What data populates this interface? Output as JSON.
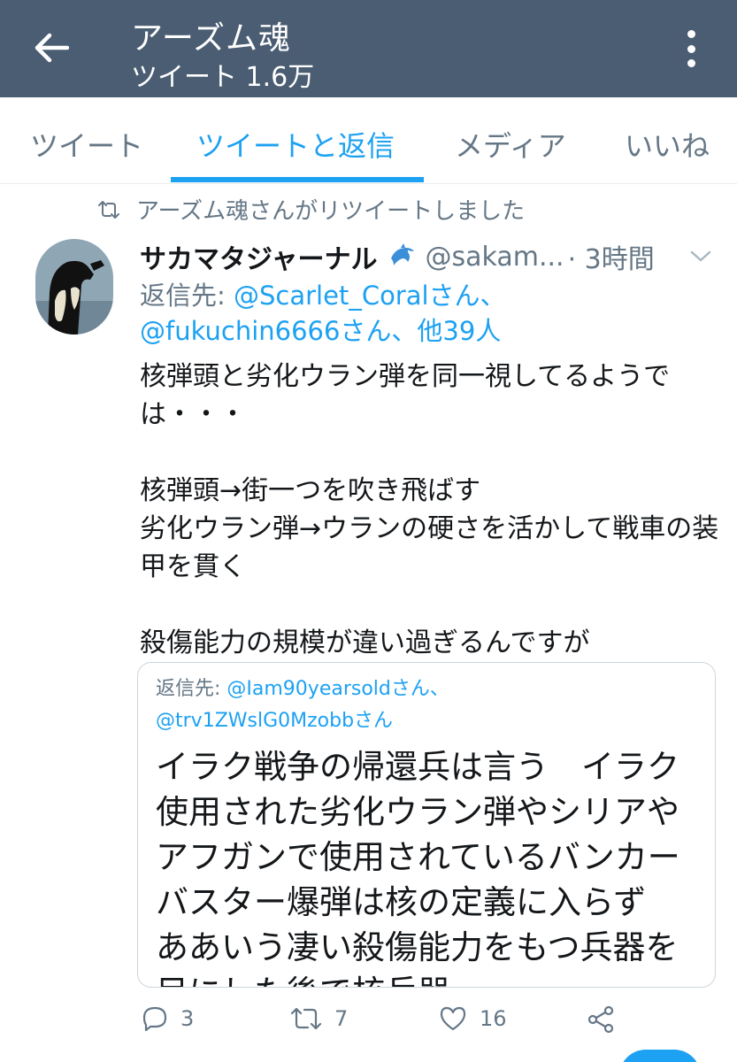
{
  "header": {
    "title": "アーズム魂",
    "tweet_count": "ツイート 1.6万",
    "background_color": "#4a5d72"
  },
  "tabs": [
    {
      "label": "ツイート",
      "active": false
    },
    {
      "label": "ツイートと返信",
      "active": true
    },
    {
      "label": "メディア",
      "active": false
    },
    {
      "label": "いいね",
      "active": false
    }
  ],
  "tweet": {
    "retweet_note": "アーズム魂さんがリツイートしました",
    "author_name": "サカマタジャーナル",
    "author_handle": "@sakam...",
    "time": "· 3時間",
    "reply_prefix": "返信先: ",
    "reply_user1": "@Scarlet_Coralさん、",
    "reply_user2": "@fukuchin6666さん、他39人",
    "body": "核弾頭と劣化ウラン弾を同一視してるようでは・・・\n\n核弾頭→街一つを吹き飛ばす\n劣化ウラン弾→ウランの硬さを活かして戦車の装甲を貫く\n\n殺傷能力の規模が違い過ぎるんですが",
    "quote": {
      "reply_prefix": "返信先: ",
      "reply_user1": "@Iam90yearsoldさん、",
      "reply_user2": "@trv1ZWslG0Mzobbさん",
      "body": "イラク戦争の帰還兵は言う　イラク使用された劣化ウラン弾やシリアやアフガンで使用されているバンカーバスター爆弾は核の定義に入らず　　ああいう凄い殺傷能力をもつ兵器を目にした後で核兵器"
    },
    "actions": {
      "reply_count": "3",
      "retweet_count": "7",
      "like_count": "16"
    }
  },
  "colors": {
    "accent": "#1da1f2",
    "muted": "#657786",
    "text": "#14171a"
  }
}
